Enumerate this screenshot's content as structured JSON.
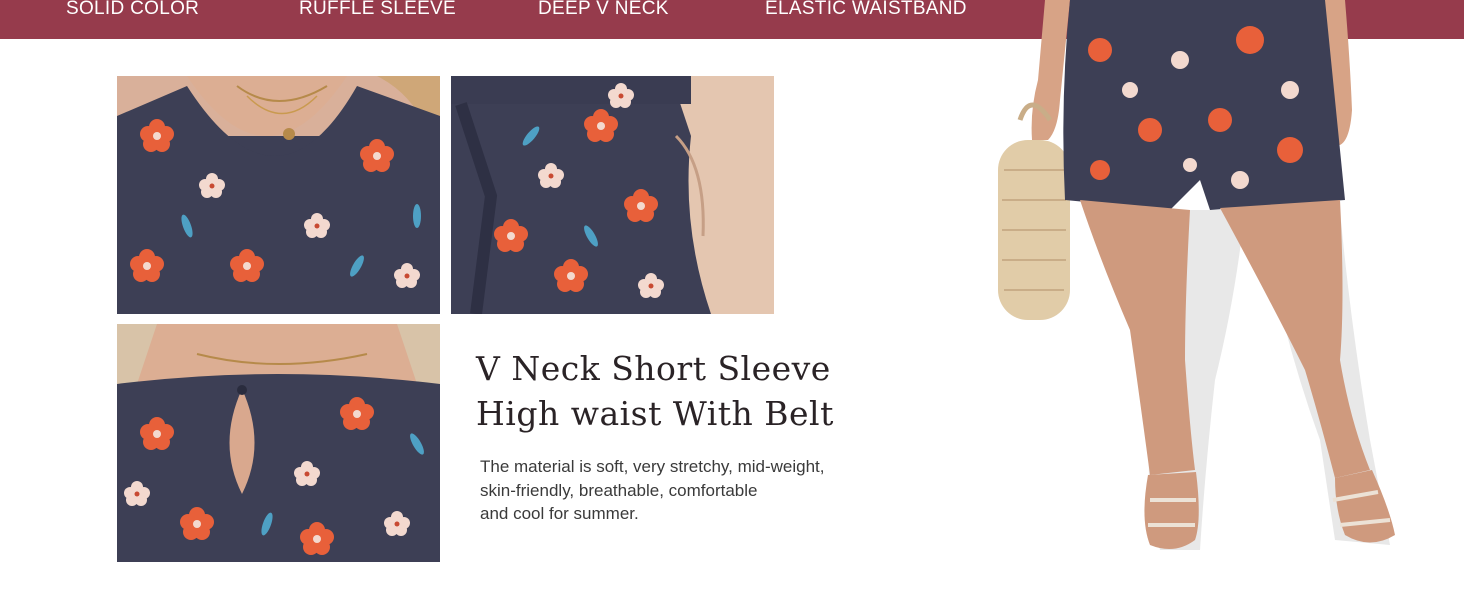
{
  "features": [
    "SOLID COLOR",
    "RUFFLE SLEEVE",
    "DEEP V NECK",
    "ELASTIC WAISTBAND"
  ],
  "headline": [
    "V Neck Short Sleeve",
    "High waist With Belt"
  ],
  "description": [
    "The material is soft, very stretchy, mid-weight,",
    "skin-friendly, breathable, comfortable",
    "and cool for summer."
  ],
  "colors": {
    "banner": "#963b4c",
    "fabric": "#3d3f55",
    "flower_orange": "#e8603a",
    "flower_cream": "#f3d9cf",
    "leaf_blue": "#4ea0c4"
  },
  "images": [
    "v-neck-closeup-photo",
    "belt-pocket-closeup-photo",
    "keyhole-back-closeup-photo",
    "model-shorts-photo"
  ]
}
